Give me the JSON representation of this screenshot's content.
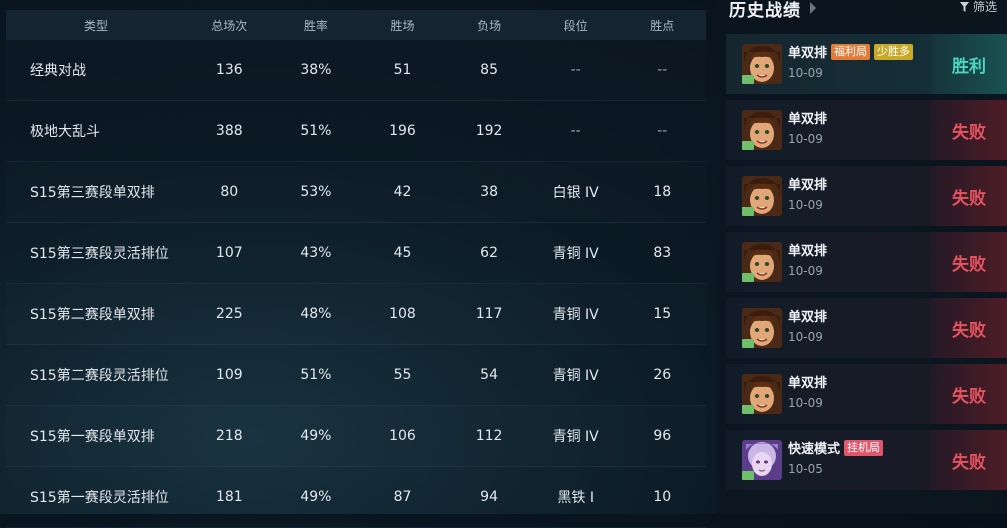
{
  "stats_table": {
    "headers": [
      "类型",
      "总场次",
      "胜率",
      "胜场",
      "负场",
      "段位",
      "胜点"
    ],
    "rows": [
      [
        "经典对战",
        "136",
        "38%",
        "51",
        "85",
        "--",
        "--"
      ],
      [
        "极地大乱斗",
        "388",
        "51%",
        "196",
        "192",
        "--",
        "--"
      ],
      [
        "S15第三赛段单双排",
        "80",
        "53%",
        "42",
        "38",
        "白银 IV",
        "18"
      ],
      [
        "S15第三赛段灵活排位",
        "107",
        "43%",
        "45",
        "62",
        "青铜 IV",
        "83"
      ],
      [
        "S15第二赛段单双排",
        "225",
        "48%",
        "108",
        "117",
        "青铜 IV",
        "15"
      ],
      [
        "S15第二赛段灵活排位",
        "109",
        "51%",
        "55",
        "54",
        "青铜 IV",
        "26"
      ],
      [
        "S15第一赛段单双排",
        "218",
        "49%",
        "106",
        "112",
        "青铜 IV",
        "96"
      ],
      [
        "S15第一赛段灵活排位",
        "181",
        "49%",
        "87",
        "94",
        "黑铁 I",
        "10"
      ]
    ]
  },
  "history": {
    "title": "历史战绩",
    "filter_label": "筛选",
    "matches": [
      {
        "mode": "单双排",
        "tags": [
          {
            "text": "福利局",
            "color": "#e07b39"
          },
          {
            "text": "少胜多",
            "color": "#c9a92a"
          }
        ],
        "date": "10-09",
        "result": "胜利",
        "outcome": "win",
        "avatar": "champion-a"
      },
      {
        "mode": "单双排",
        "tags": [],
        "date": "10-09",
        "result": "失败",
        "outcome": "lose",
        "avatar": "champion-a"
      },
      {
        "mode": "单双排",
        "tags": [],
        "date": "10-09",
        "result": "失败",
        "outcome": "lose",
        "avatar": "champion-a"
      },
      {
        "mode": "单双排",
        "tags": [],
        "date": "10-09",
        "result": "失败",
        "outcome": "lose",
        "avatar": "champion-a"
      },
      {
        "mode": "单双排",
        "tags": [],
        "date": "10-09",
        "result": "失败",
        "outcome": "lose",
        "avatar": "champion-a"
      },
      {
        "mode": "单双排",
        "tags": [],
        "date": "10-09",
        "result": "失败",
        "outcome": "lose",
        "avatar": "champion-a"
      },
      {
        "mode": "快速模式",
        "tags": [
          {
            "text": "挂机局",
            "color": "#e0566a"
          }
        ],
        "date": "10-05",
        "result": "失败",
        "outcome": "lose",
        "avatar": "champion-b"
      }
    ]
  }
}
